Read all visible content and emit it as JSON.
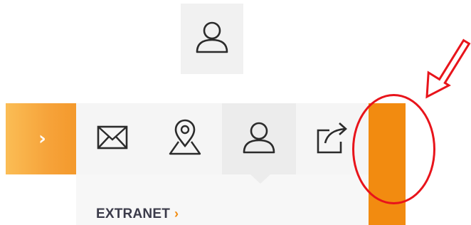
{
  "colors": {
    "accent": "#f28b10",
    "annotation": "#e8141b"
  },
  "top_icon": {
    "icon": "user-icon"
  },
  "toolbar": {
    "toggle": {
      "icon": "chevron-right-icon",
      "glyph": "›"
    },
    "buttons": [
      {
        "name": "mail",
        "icon": "mail-icon"
      },
      {
        "name": "location",
        "icon": "map-pin-icon"
      },
      {
        "name": "account",
        "icon": "user-icon",
        "active": true
      },
      {
        "name": "share",
        "icon": "share-icon"
      }
    ]
  },
  "dropdown": {
    "link_label": "EXTRANET",
    "link_arrow": "›"
  },
  "annotation": {
    "shapes": [
      "circle",
      "arrow"
    ]
  }
}
